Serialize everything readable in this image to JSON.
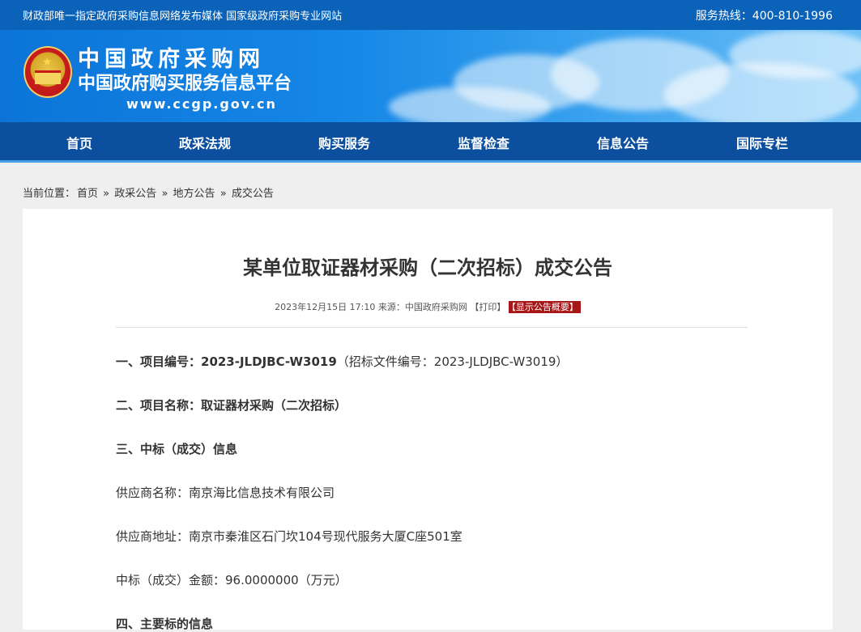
{
  "topbar": {
    "left_text": "财政部唯一指定政府采购信息网络发布媒体 国家级政府采购专业网站",
    "hotline": "服务热线：400-810-1996"
  },
  "brand": {
    "line1": "中国政府采购网",
    "line2": "中国政府购买服务信息平台",
    "url": "www.ccgp.gov.cn"
  },
  "nav": [
    "首页",
    "政采法规",
    "购买服务",
    "监督检查",
    "信息公告",
    "国际专栏"
  ],
  "breadcrumb": {
    "label": "当前位置：",
    "items": [
      "首页",
      "»",
      "政采公告",
      "»",
      "地方公告",
      "»",
      "成交公告"
    ]
  },
  "article": {
    "title": "某单位取证器材采购（二次招标）成交公告",
    "meta": "2023年12月15日 17:10 来源：中国政府采购网 【打印】",
    "summary_tag": "【显示公告概要】",
    "lines": [
      {
        "bold": "一、项目编号：2023-JLDJBC-W3019",
        "normal": "（招标文件编号：2023-JLDJBC-W3019）"
      },
      {
        "bold": "二、项目名称：取证器材采购（二次招标）",
        "normal": ""
      },
      {
        "bold": "三、中标（成交）信息",
        "normal": ""
      },
      {
        "bold": "",
        "normal": "供应商名称：南京海比信息技术有限公司"
      },
      {
        "bold": "",
        "normal": "供应商地址：南京市秦淮区石门坎104号现代服务大厦C座501室"
      },
      {
        "bold": "",
        "normal": "中标（成交）金额：96.0000000（万元）"
      },
      {
        "bold": "四、主要标的信息",
        "normal": ""
      }
    ]
  },
  "colors": {
    "topbar": "#0a63b8",
    "nav": "#0b4f9e",
    "tag": "#a81717"
  }
}
